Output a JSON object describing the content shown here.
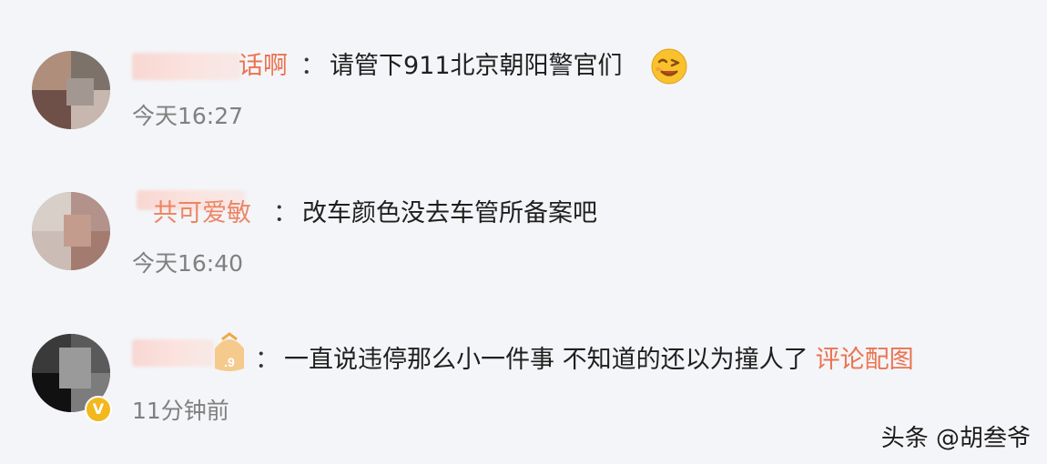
{
  "comments": [
    {
      "name_visible": "话啊",
      "colon": "：",
      "text": "请管下911北京朝阳警官们",
      "time": "今天16:27",
      "emoji": "wink-face-emoji"
    },
    {
      "name_visible": "共可爱敏",
      "colon": "：",
      "text": "改车颜色没去车管所备案吧",
      "time": "今天16:40"
    },
    {
      "name_visible": "",
      "colon": "：",
      "text": "一直说违停那么小一件事 不知道的还以为撞人了",
      "link": "评论配图",
      "time": "11分钟前",
      "badge": "V"
    }
  ],
  "watermark": "头条 @胡叁爷",
  "colors": {
    "background": "#f4f5f8",
    "username": "#eb7350",
    "text": "#1f1f1f",
    "time": "#808080",
    "badge": "#f2b81d"
  }
}
